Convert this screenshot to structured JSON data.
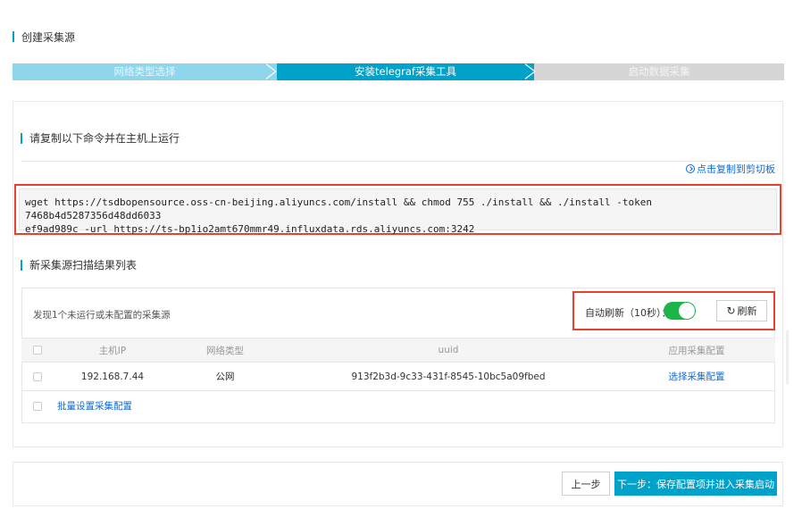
{
  "page": {
    "title": "创建采集源"
  },
  "steps": [
    {
      "label": "网络类型选择",
      "state": "done"
    },
    {
      "label": "安装telegraf采集工具",
      "state": "active"
    },
    {
      "label": "启动数据采集",
      "state": "pending"
    }
  ],
  "install": {
    "section_title": "请复制以下命令并在主机上运行",
    "copy_label": "点击复制到剪切板",
    "command_line1": "wget https://tsdbopensource.oss-cn-beijing.aliyuncs.com/install && chmod 755 ./install && ./install -token 7468b4d5287356d48dd6033",
    "command_line2": "ef9ad989c -url https://ts-bp1io2amt670mmr49.influxdata.rds.aliyuncs.com:3242"
  },
  "scan": {
    "section_title": "新采集源扫描结果列表",
    "found_text": "发现1个未运行或未配置的采集源",
    "auto_refresh_label": "自动刷新（10秒）：",
    "auto_refresh_on": true,
    "refresh_button": "刷新",
    "columns": {
      "ip": "主机IP",
      "network": "网络类型",
      "uuid": "uuid",
      "config": "应用采集配置"
    },
    "rows": [
      {
        "ip": "192.168.7.44",
        "network": "公网",
        "uuid": "913f2b3d-9c33-431f-8545-10bc5a09fbed",
        "config_link": "选择采集配置"
      }
    ],
    "batch_link": "批量设置采集配置"
  },
  "footer": {
    "prev_button": "上一步",
    "next_button": "下一步：保存配置项并进入采集启动"
  },
  "colors": {
    "accent": "#00a2ca",
    "highlight": "#e8412e",
    "toggle_on": "#1bb54a",
    "link": "#0d6ad8"
  }
}
